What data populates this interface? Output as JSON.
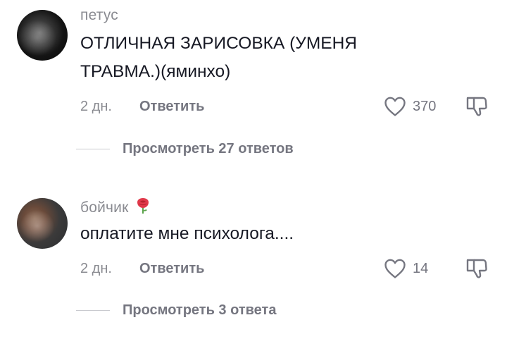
{
  "comments": [
    {
      "username": "петус",
      "text_line1": "ОТЛИЧНАЯ ЗАРИСОВКА (УМЕНЯ",
      "text_line2": "ТРАВМА.)(яминхо)",
      "date": "2 дн.",
      "reply_label": "Ответить",
      "likes": "370",
      "view_replies": "Просмотреть 27 ответов"
    },
    {
      "username": "бойчик",
      "username_emoji": "rose-icon",
      "text": "оплатите мне психолога....",
      "date": "2 дн.",
      "reply_label": "Ответить",
      "likes": "14",
      "view_replies": "Просмотреть 3 ответа"
    }
  ],
  "icons": {
    "like": "heart-outline-icon",
    "dislike": "thumbs-down-icon"
  },
  "colors": {
    "text": "#161823",
    "secondary": "#8a8b91",
    "action": "#757680",
    "rose": "#e0394a"
  }
}
